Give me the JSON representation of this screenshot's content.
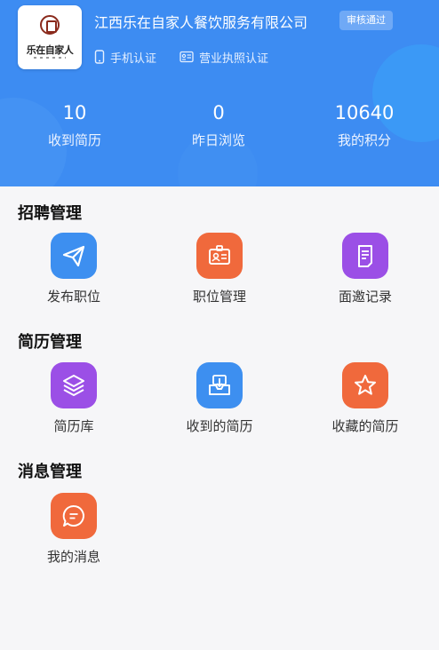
{
  "header": {
    "logo_text": "乐在自家人",
    "company_name": "江西乐在自家人餐饮服务有限公司",
    "status_badge": "审核通过",
    "certifications": [
      "手机认证",
      "营业执照认证"
    ],
    "stats": [
      {
        "value": "10",
        "label": "收到简历"
      },
      {
        "value": "0",
        "label": "昨日浏览"
      },
      {
        "value": "10640",
        "label": "我的积分"
      }
    ]
  },
  "sections": [
    {
      "title": "招聘管理",
      "items": [
        {
          "label": "发布职位",
          "icon": "paper-plane-icon",
          "color": "#3d8ff0"
        },
        {
          "label": "职位管理",
          "icon": "id-card-icon",
          "color": "#f0693c"
        },
        {
          "label": "面邀记录",
          "icon": "document-icon",
          "color": "#9b4fe6"
        }
      ]
    },
    {
      "title": "简历管理",
      "items": [
        {
          "label": "简历库",
          "icon": "layers-icon",
          "color": "#9b4fe6"
        },
        {
          "label": "收到的简历",
          "icon": "inbox-download-icon",
          "color": "#3d8ff0"
        },
        {
          "label": "收藏的简历",
          "icon": "star-icon",
          "color": "#f0693c"
        }
      ]
    },
    {
      "title": "消息管理",
      "items": [
        {
          "label": "我的消息",
          "icon": "chat-bubble-icon",
          "color": "#f0693c"
        }
      ]
    }
  ],
  "colors": {
    "header_bg": "#3d8cf2",
    "page_bg": "#f6f6f8",
    "blue": "#3d8ff0",
    "orange": "#f0693c",
    "purple": "#9b4fe6"
  }
}
